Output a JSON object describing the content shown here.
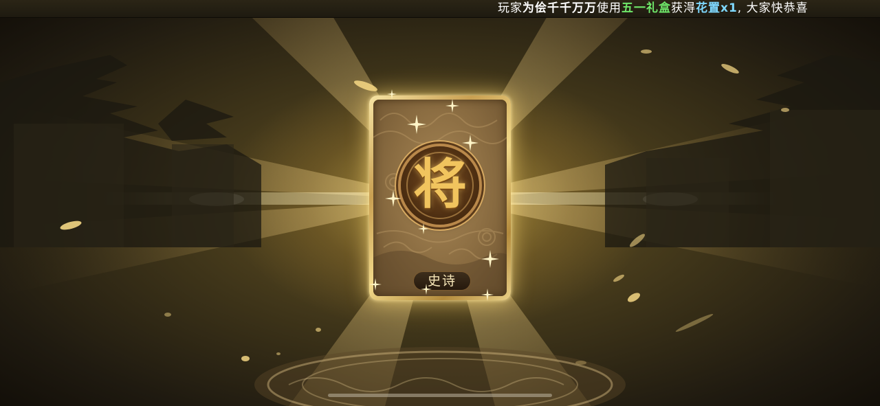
{
  "notice": {
    "prefix": "玩家",
    "player": "为侩千千万万",
    "verb": "使用",
    "item": "五一礼盒",
    "obtained": "获淂",
    "reward": "花置x1",
    "suffix": ", 大家快恭喜"
  },
  "card": {
    "glyph": "将",
    "rarity": "史诗"
  },
  "colors": {
    "item_highlight": "#6fe86a",
    "reward_highlight": "#7fd9ff",
    "card_gold": "#f2d98a",
    "glyph_gold": "#f1c45e"
  }
}
